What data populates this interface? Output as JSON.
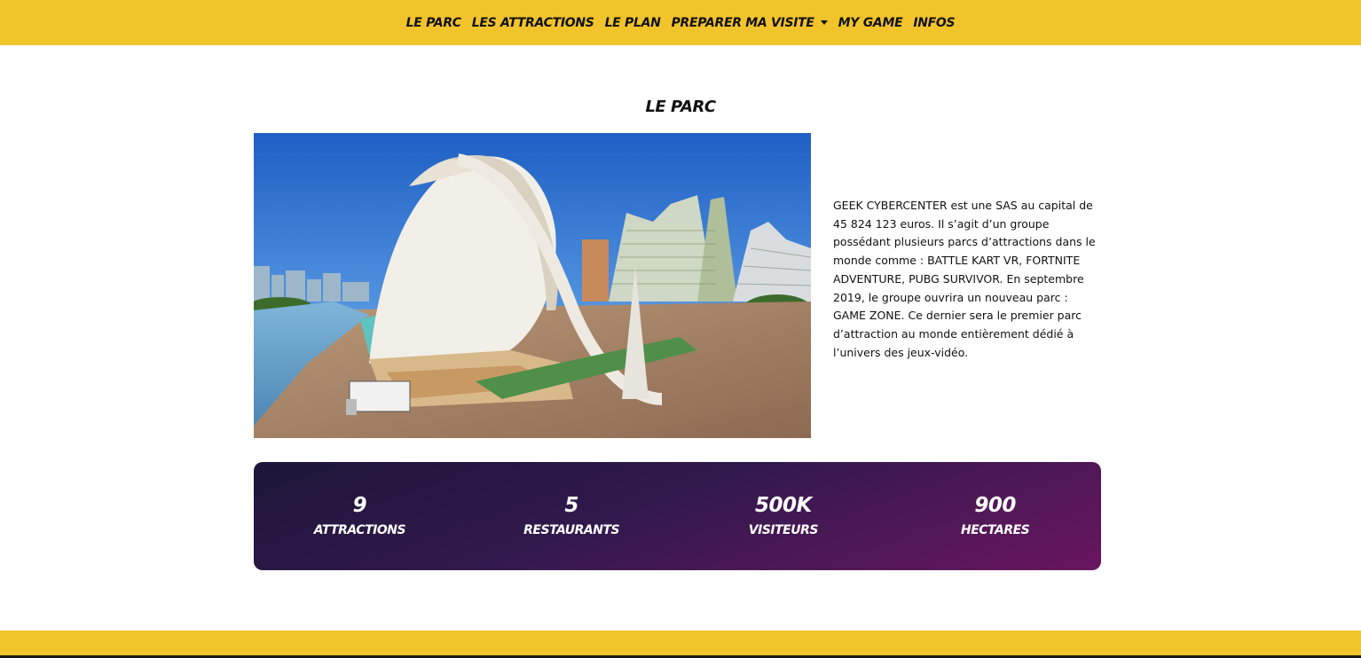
{
  "nav": {
    "items": [
      {
        "label": "LE PARC"
      },
      {
        "label": "LES ATTRACTIONS"
      },
      {
        "label": "LE PLAN"
      },
      {
        "label": "PREPARER MA VISITE"
      },
      {
        "label": "MY GAME"
      },
      {
        "label": "INFOS"
      }
    ]
  },
  "page": {
    "title": "LE PARC",
    "intro": "GEEK CYBERCENTER est une SAS au capital de 45 824 123 euros. Il s’agit d’un groupe possédant plusieurs parcs d’attractions dans le monde comme : BATTLE KART VR, FORTNITE ADVENTURE, PUBG SURVIVOR. En septembre 2019, le groupe ouvrira un nouveau parc : GAME ZONE. Ce dernier sera le premier parc d’attraction au monde entièrement dédié à l’univers des jeux-vidéo."
  },
  "stats": [
    {
      "value": "9",
      "label": "ATTRACTIONS"
    },
    {
      "value": "5",
      "label": "RESTAURANTS"
    },
    {
      "value": "500K",
      "label": "VISITEURS"
    },
    {
      "value": "900",
      "label": "HECTARES"
    }
  ],
  "colors": {
    "nav_bg": "#f2c42c",
    "stats_gradient_start": "#1d1538",
    "stats_gradient_end": "#6a165f",
    "text": "#111111"
  },
  "icons": {
    "dropdown": "caret-down-icon"
  }
}
